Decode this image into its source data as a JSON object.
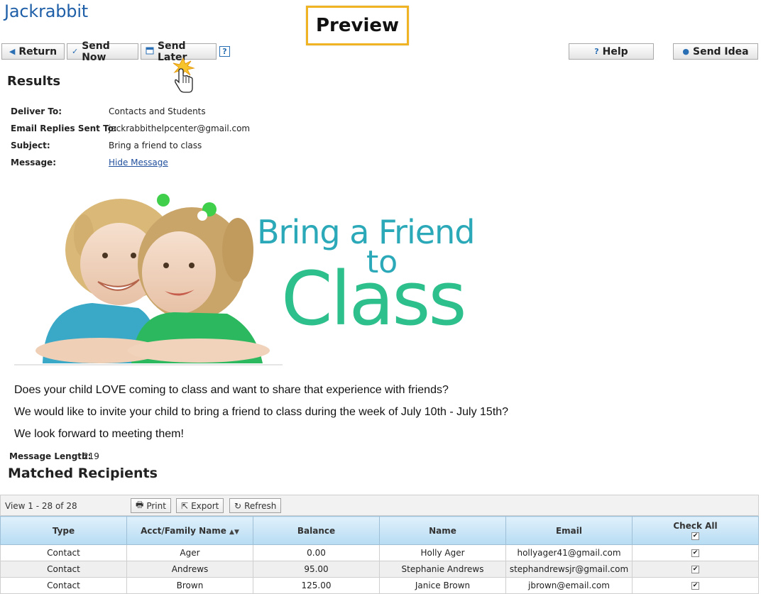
{
  "app": {
    "logo": "Jackrabbit",
    "overlay_label": "Preview"
  },
  "toolbar": {
    "return_label": "Return",
    "send_now_label": "Send Now",
    "send_later_label": "Send Later",
    "help_q": "?",
    "help_label": "Help",
    "send_idea_label": "Send Idea"
  },
  "results": {
    "heading": "Results",
    "deliver_to_label": "Deliver To:",
    "deliver_to_value": "Contacts and Students",
    "replies_label": "Email Replies Sent To:",
    "replies_value": "jackrabbithelpcenter@gmail.com",
    "subject_label": "Subject:",
    "subject_value": "Bring a friend to class",
    "message_label": "Message:",
    "message_link": "Hide Message"
  },
  "hero": {
    "line1": "Bring a Friend",
    "line2": "to",
    "line3": "Class"
  },
  "message": {
    "lines": [
      "Does your child LOVE coming to class and want to share that experience with friends?",
      "We would like to invite your child to bring a friend to class during the week of July 10th - July 15th?",
      "We look forward to meeting them!"
    ],
    "length_label": "Message Length:",
    "length_value": "219"
  },
  "recipients": {
    "heading": "Matched Recipients",
    "view_text": "View 1 - 28 of 28",
    "print_label": "Print",
    "export_label": "Export",
    "refresh_label": "Refresh",
    "columns": [
      "Type",
      "Acct/Family Name",
      "Balance",
      "Name",
      "Email",
      "Check All"
    ],
    "rows": [
      {
        "type": "Contact",
        "family": "Ager",
        "balance": "0.00",
        "name": "Holly Ager",
        "email": "hollyager41@gmail.com",
        "checked": true
      },
      {
        "type": "Contact",
        "family": "Andrews",
        "balance": "95.00",
        "name": "Stephanie Andrews",
        "email": "stephandrewsjr@gmail.com",
        "checked": true
      },
      {
        "type": "Contact",
        "family": "Brown",
        "balance": "125.00",
        "name": "Janice Brown",
        "email": "jbrown@email.com",
        "checked": true
      }
    ]
  },
  "colors": {
    "brand": "#1f5fa8",
    "highlight": "#f0b323",
    "hero_teal": "#2ba9b8",
    "hero_green": "#2dbf8c",
    "header_blue": "#b7dcf3"
  }
}
